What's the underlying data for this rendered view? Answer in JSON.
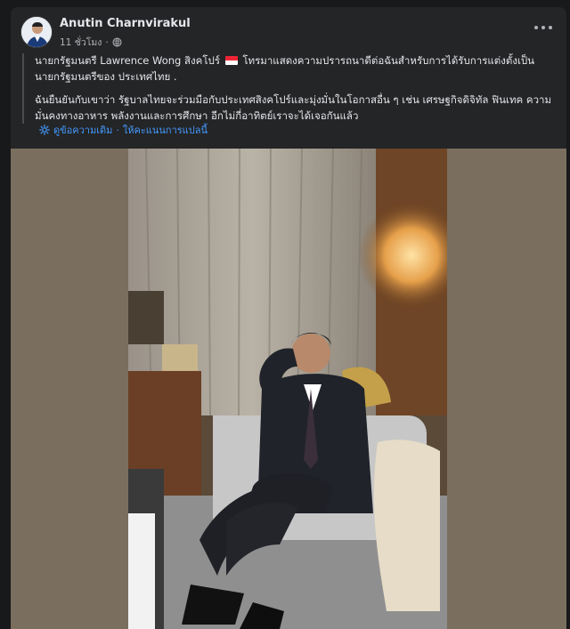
{
  "post": {
    "author": "Anutin Charnvirakul",
    "timestamp": "11 ชั่วโมง",
    "separator": "·",
    "privacy_icon": "globe-icon",
    "menu_icon": "more-options-icon",
    "paragraph1_before_flag": "นายกรัฐมนตรี Lawrence Wong สิงคโปร์",
    "paragraph1_after_flag": "โทรมาแสดงความปรารถนาดีต่อฉันสำหรับการได้รับการแต่งตั้งเป็นนายกรัฐมนตรีของ ประเทศไทย .",
    "paragraph2": "ฉันยืนยันกับเขาว่า รัฐบาลไทยจะร่วมมือกับประเทศสิงคโปร์และมุ่งมั่นในโอกาสอื่น ๆ เช่น เศรษฐกิจดิจิทัล ฟินเทค ความมั่นคงทางอาหาร พลังงานและการศึกษา อีกไม่กี่อาทิตย์เราจะได้เจอกันแล้ว",
    "see_original": "ดูข้อความเดิม",
    "link_separator": "·",
    "rate_translation": "ให้คะแนนการแปลนี้"
  },
  "colors": {
    "card_bg": "#242526",
    "text": "#e4e6eb",
    "muted": "#b0b3b8",
    "link": "#4599ff"
  }
}
